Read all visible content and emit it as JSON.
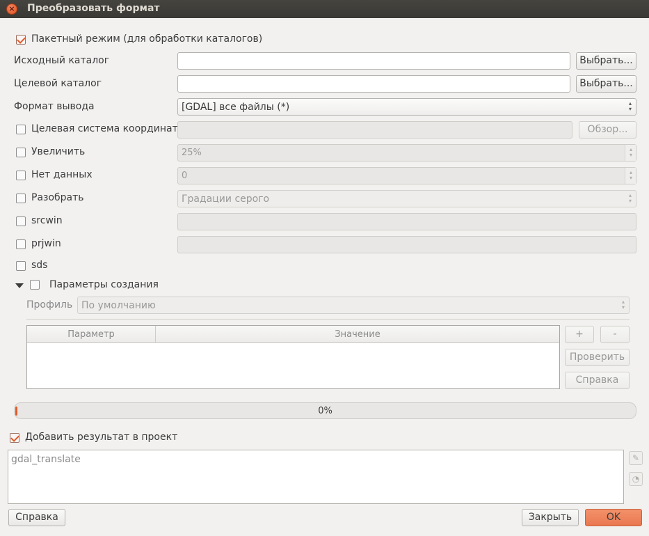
{
  "window": {
    "title": "Преобразовать формат"
  },
  "batch": {
    "label": "Пакетный режим (для обработки каталогов)",
    "checked": true
  },
  "source": {
    "label": "Исходный каталог",
    "value": "",
    "button": "Выбрать..."
  },
  "target": {
    "label": "Целевой каталог",
    "value": "",
    "button": "Выбрать..."
  },
  "output_format": {
    "label": "Формат вывода",
    "value": "[GDAL] все файлы (*)"
  },
  "target_srs": {
    "label": "Целевая система координат",
    "value": "",
    "button": "Обзор..."
  },
  "scale": {
    "label": "Увеличить",
    "value": "25%"
  },
  "nodata": {
    "label": "Нет данных",
    "value": "0"
  },
  "expand": {
    "label": "Разобрать",
    "value": "Градации серого"
  },
  "srcwin": {
    "label": "srcwin",
    "value": ""
  },
  "prjwin": {
    "label": "prjwin",
    "value": ""
  },
  "sds": {
    "label": "sds"
  },
  "creation": {
    "label": "Параметры создания",
    "profile_label": "Профиль",
    "profile_value": "По умолчанию",
    "columns": [
      "Параметр",
      "Значение"
    ],
    "add": "+",
    "remove": "-",
    "validate": "Проверить",
    "help": "Справка"
  },
  "progress": {
    "text": "0%",
    "value": 0
  },
  "add_to_project": {
    "label": "Добавить результат в проект",
    "checked": true
  },
  "command": {
    "text": "gdal_translate"
  },
  "footer": {
    "help": "Справка",
    "close": "Закрыть",
    "ok": "OK"
  },
  "colors": {
    "accent": "#e05a2a",
    "ok_button": "#f08660",
    "titlebar": "#3f3e3a"
  }
}
